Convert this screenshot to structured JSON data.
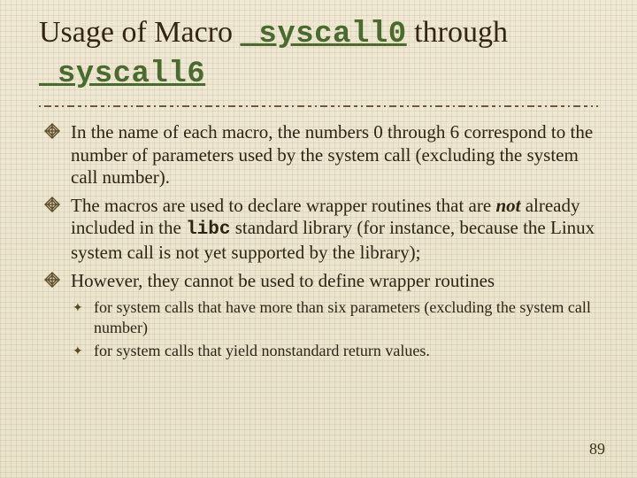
{
  "title": {
    "t1": "Usage of Macro ",
    "code1": "_syscall0",
    "t2": " through ",
    "code2": "_syscall6"
  },
  "bullets": [
    {
      "text": "In the name of each macro, the numbers 0 through 6 correspond to the number of parameters used by the system call (excluding the system call number)."
    },
    {
      "pre": "The macros are used to declare wrapper routines that are ",
      "em": "not",
      "mid": " already included in the ",
      "code": "libc",
      "post": " standard library (for instance, because the Linux system call is not yet supported by the library);"
    },
    {
      "text": "However, they cannot be used to define wrapper routines",
      "subs": [
        "for system calls that have more than six parameters (excluding the system call number)",
        "for system calls that yield nonstandard return values."
      ]
    }
  ],
  "page_number": "89"
}
